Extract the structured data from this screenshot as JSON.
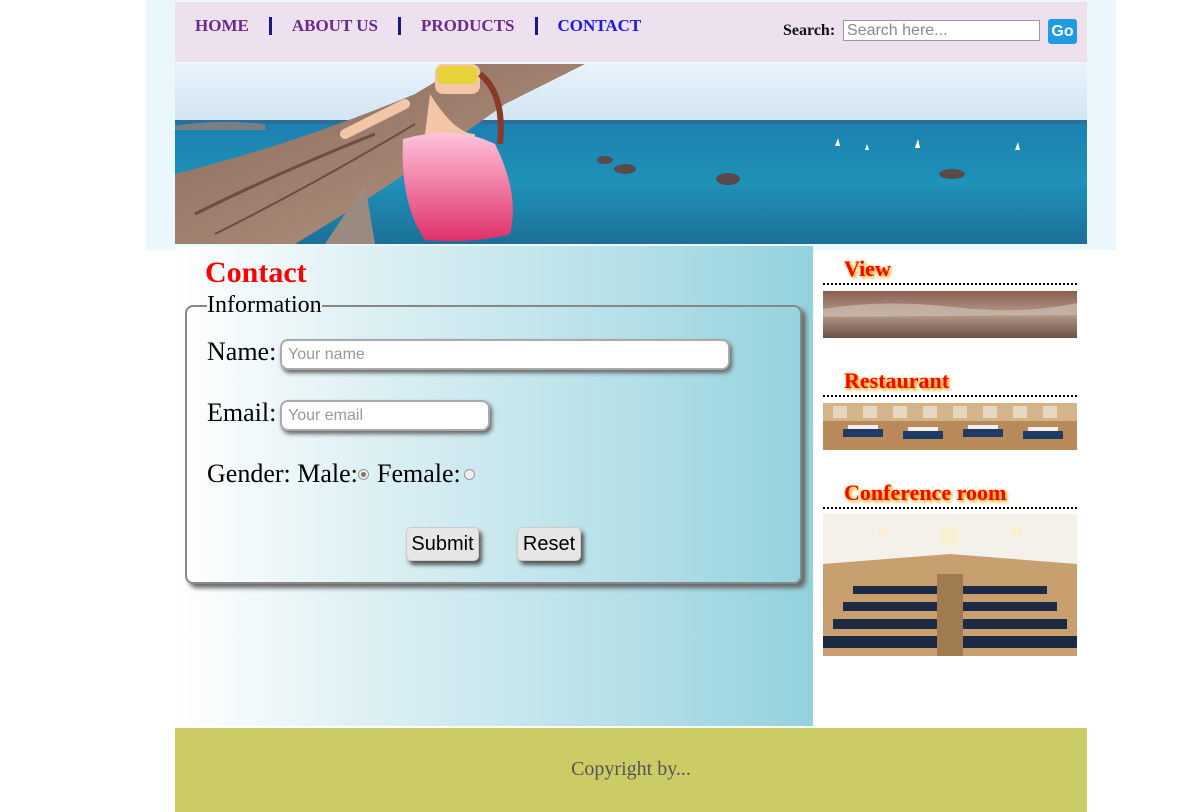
{
  "nav": {
    "items": [
      {
        "label": "HOME"
      },
      {
        "label": "ABOUT US"
      },
      {
        "label": "PRODUCTS"
      },
      {
        "label": "CONTACT"
      }
    ]
  },
  "search": {
    "label": "Search:",
    "placeholder": "Search here...",
    "button_label": "Go"
  },
  "main": {
    "title": "Contact",
    "legend": "Information",
    "name_label": "Name:",
    "name_placeholder": "Your name",
    "email_label": "Email:",
    "email_placeholder": "Your email",
    "gender_label": "Gender: Male:",
    "female_label": "Female:",
    "submit_label": "Submit",
    "reset_label": "Reset"
  },
  "sidebar": {
    "sections": [
      {
        "title": "View"
      },
      {
        "title": "Restaurant"
      },
      {
        "title": "Conference room"
      }
    ]
  },
  "footer": {
    "text": "Copyright by..."
  },
  "colors": {
    "header_bg": "#ede0ef",
    "nav_link": "#6a2a8a",
    "nav_active": "#1a1ae6",
    "heading_red": "#ff0000",
    "footer_bg": "#cccc66",
    "go_button": "#1e9be3"
  }
}
